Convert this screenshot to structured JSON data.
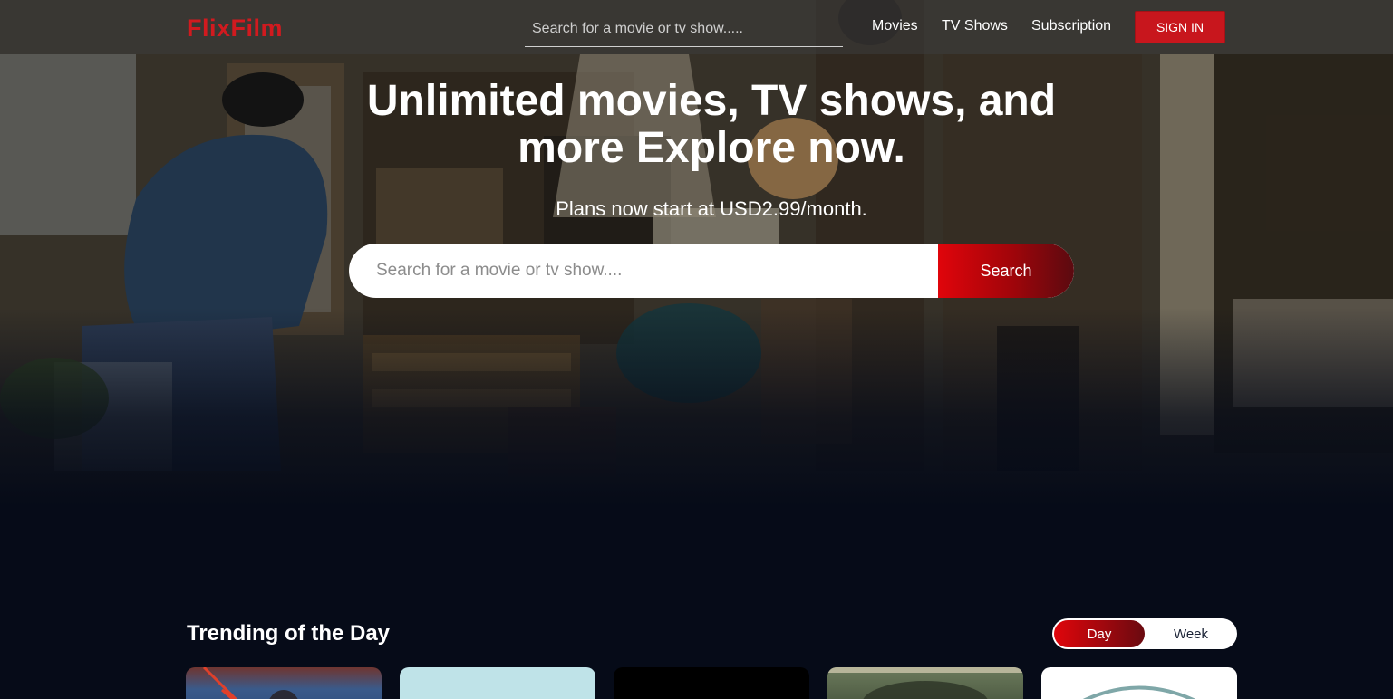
{
  "brand": {
    "name": "FlixFilm",
    "color": "#d11a1f"
  },
  "nav": {
    "search_placeholder": "Search for a movie or tv show.....",
    "links": [
      "Movies",
      "TV Shows",
      "Subscription"
    ],
    "signin_label": "SIGN IN"
  },
  "hero": {
    "headline_line1": "Unlimited movies, TV shows, and",
    "headline_line2": "more Explore now.",
    "subtitle": "Plans now start at USD2.99/month.",
    "search_placeholder": "Search for a movie or tv show....",
    "search_button": "Search"
  },
  "trending": {
    "title": "Trending of the Day",
    "toggle": {
      "day": "Day",
      "week": "Week",
      "selected": "Day"
    },
    "cards": [
      {
        "name": "card-1",
        "theme": "#3a5a8a"
      },
      {
        "name": "card-2",
        "theme": "#bfe3e8"
      },
      {
        "name": "card-3",
        "theme": "#000000"
      },
      {
        "name": "card-4",
        "theme": "#4a5740"
      },
      {
        "name": "card-5",
        "theme": "#ffffff"
      }
    ]
  },
  "colors": {
    "accent": "#d11a1f",
    "page_bg": "#060b18"
  }
}
